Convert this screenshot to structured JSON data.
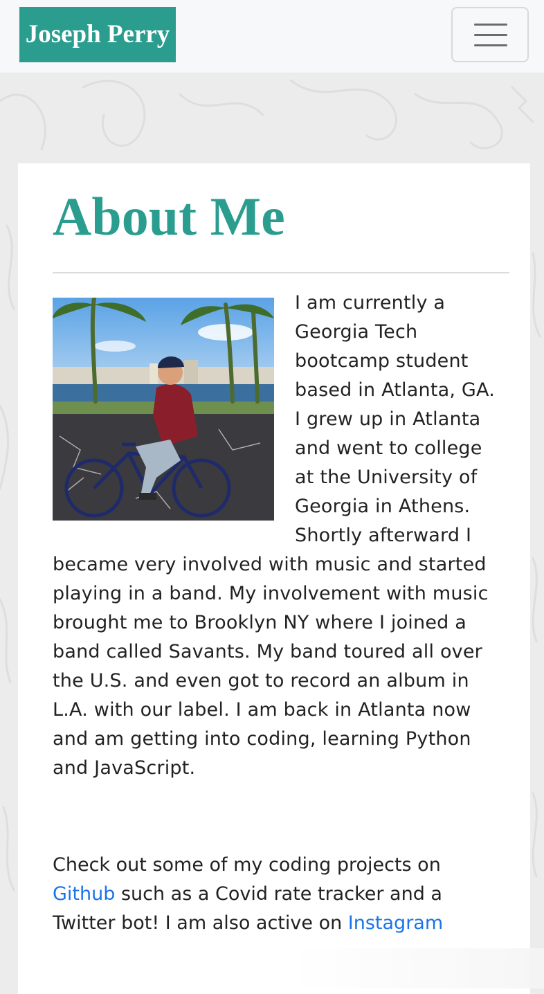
{
  "navbar": {
    "brand": "Joseph Perry",
    "toggle_icon": "hamburger-menu-icon"
  },
  "about": {
    "title": "About Me",
    "photo": {
      "description": "man riding a bicycle by the water under palm trees"
    },
    "bio": "I am currently a Georgia Tech bootcamp student based in Atlanta, GA. I grew up in Atlanta and went to college at the University of Georgia in Athens. Shortly afterward I became very involved with music and started playing in a band. My involvement with music brought me to Brooklyn NY where I joined a band called Savants. My band toured all over the U.S. and even got to record an album in L.A. with our label. I am back in Atlanta now and am getting into coding, learning Python and JavaScript.",
    "projects": {
      "text_1": "Check out some of my coding projects on ",
      "link_github": "Github",
      "text_2": " such as a Covid rate tracker and a Twitter bot! I am also active on ",
      "link_instagram": "Instagram"
    }
  },
  "colors": {
    "accent": "#2a9d8f",
    "link": "#1a73e8",
    "page_background": "#ececec"
  }
}
